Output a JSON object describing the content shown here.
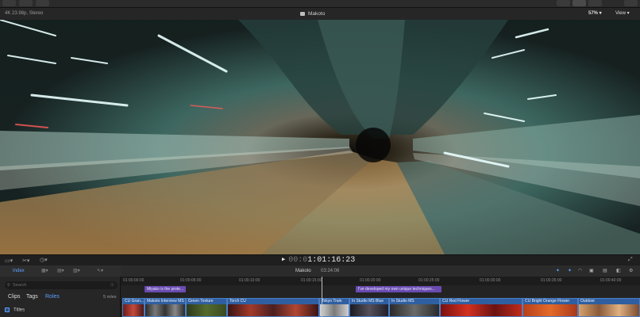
{
  "viewer": {
    "format": "4K 23.98p, Stereo",
    "title": "Makoto",
    "zoom": "57%",
    "view_menu": "View",
    "timecode_lead": "00:0",
    "timecode": "1:01:16:23"
  },
  "browser": {
    "tab_index": "Index",
    "search_placeholder": "Search",
    "filter_clips": "Clips",
    "filter_tags": "Tags",
    "filter_roles": "Roles",
    "roles_count": "5 roles",
    "row_titles": "Titles"
  },
  "timeline": {
    "project_name": "Makoto",
    "duration": "03:24:06",
    "ruler": [
      "01:00:00:00",
      "01:00:05:00",
      "01:00:10:00",
      "01:00:15:00",
      "01:00:20:00",
      "01:00:25:00",
      "01:00:30:00",
      "01:00:35:00",
      "01:00:40:00"
    ],
    "markers": [
      "Miyako is the prote...",
      "I've developed my own unique techniques..."
    ],
    "clips": [
      "CU Gran...",
      "Makoto Interview MS",
      "Green Texture",
      "Torch CU",
      "Tokyo Train",
      "In Studio MS Blue",
      "In Studio MS",
      "CU Red Flower",
      "CU Bright Orange Flower",
      "Outdoor"
    ]
  },
  "colors": {
    "accent": "#5ea0ff",
    "clip": "#2f5fa0",
    "marker": "#6a4bb0"
  }
}
